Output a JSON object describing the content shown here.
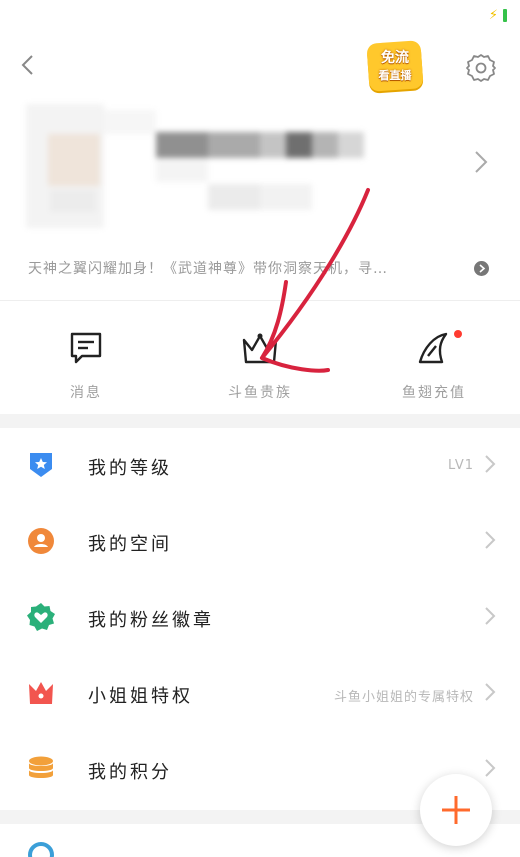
{
  "status_bar": {
    "charge_icon": "lightning-icon",
    "battery_color": "#35c24a"
  },
  "topbar": {
    "back_icon": "chevron-left-icon",
    "promo_badge": {
      "line1": "免流",
      "line2": "看直播",
      "color": "#ffc82c"
    },
    "settings_icon": "gear-icon"
  },
  "profile": {
    "chevron_icon": "chevron-right-icon"
  },
  "intro": {
    "text": "天神之翼闪耀加身！《武道神尊》带你洞察天机，寻…"
  },
  "quick_actions": [
    {
      "label": "消息",
      "icon": "message-icon"
    },
    {
      "label": "斗鱼贵族",
      "icon": "crown-icon"
    },
    {
      "label": "鱼翅充值",
      "icon": "fin-icon",
      "has_dot": true
    }
  ],
  "menu": [
    {
      "label": "我的等级",
      "value": "LV1",
      "icon": "shield-star-icon",
      "color": "#3b8cf0"
    },
    {
      "label": "我的空间",
      "value": "",
      "icon": "person-circle-icon",
      "color": "#f0883a"
    },
    {
      "label": "我的粉丝徽章",
      "value": "",
      "icon": "heart-badge-icon",
      "color": "#2bb07a"
    },
    {
      "label": "小姐姐特权",
      "value": "斗鱼小姐姐的专属特权",
      "icon": "crown-fill-icon",
      "color": "#f2554f"
    },
    {
      "label": "我的积分",
      "value": "",
      "icon": "coins-icon",
      "color": "#f2a03a"
    }
  ],
  "fab": {
    "icon": "plus-icon",
    "color": "#ff6a2c"
  },
  "annotation_color": "#d8233e"
}
